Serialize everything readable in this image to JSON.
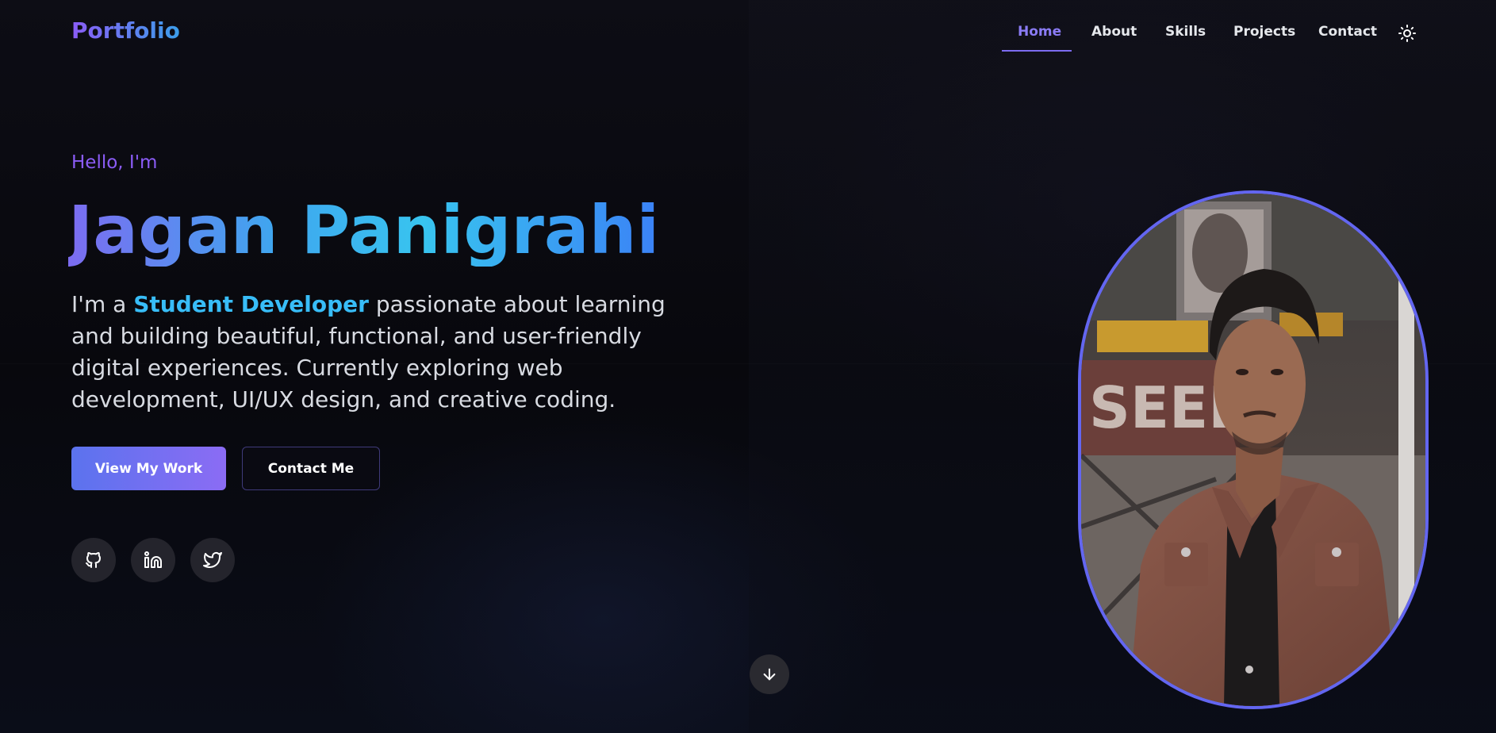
{
  "nav": {
    "logo": "Portfolio",
    "items": [
      {
        "label": "Home",
        "active": true
      },
      {
        "label": "About",
        "active": false
      },
      {
        "label": "Skills",
        "active": false
      },
      {
        "label": "Projects",
        "active": false
      },
      {
        "label": "Contact",
        "active": false
      }
    ],
    "theme_icon": "sun-icon"
  },
  "hero": {
    "greeting": "Hello, I'm",
    "name": "Jagan Panigrahi",
    "intro_prefix": "I'm a ",
    "intro_highlight": "Student Developer",
    "intro_suffix": " passionate about learning and building beautiful, functional, and user-friendly digital experiences. Currently exploring web development, UI/UX design, and creative coding.",
    "primary_button": "View My Work",
    "secondary_button": "Contact Me",
    "socials": [
      "github-icon",
      "linkedin-icon",
      "twitter-icon"
    ],
    "scroll_icon": "arrow-down-icon"
  },
  "colors": {
    "accent_purple": "#8b5cf6",
    "accent_cyan": "#38bdf8",
    "accent_blue": "#3b82f6",
    "background": "#0b0b12"
  }
}
